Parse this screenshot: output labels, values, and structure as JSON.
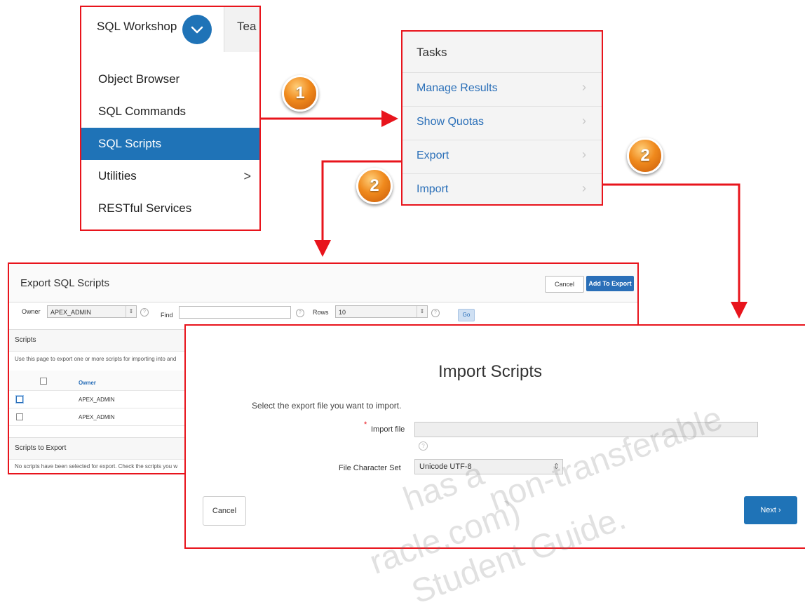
{
  "menu": {
    "tabs": [
      "SQL Workshop",
      "Tea"
    ],
    "items": [
      {
        "label": "Object Browser"
      },
      {
        "label": "SQL Commands"
      },
      {
        "label": "SQL Scripts"
      },
      {
        "label": "Utilities",
        "arrow": ">"
      },
      {
        "label": "RESTful Services"
      }
    ]
  },
  "tasks": {
    "title": "Tasks",
    "items": [
      "Manage Results",
      "Show Quotas",
      "Export",
      "Import"
    ]
  },
  "badges": {
    "one": "1",
    "two": "2"
  },
  "export": {
    "title": "Export SQL Scripts",
    "cancel_label": "Cancel",
    "add_label": "Add To Export",
    "owner_label": "Owner",
    "owner_value": "APEX_ADMIN",
    "find_label": "Find",
    "rows_label": "Rows",
    "rows_value": "10",
    "go_label": "Go",
    "scripts_heading": "Scripts",
    "scripts_desc": "Use this page to export one or more scripts for importing into and",
    "owner_col": "Owner",
    "rows": [
      "APEX_ADMIN",
      "APEX_ADMIN"
    ],
    "to_export_heading": "Scripts to Export",
    "to_export_desc": "No scripts have been selected for export. Check the scripts you w"
  },
  "import": {
    "title": "Import Scripts",
    "instruction": "Select the export file you want to import.",
    "required_mark": "*",
    "file_label": "Import file",
    "charset_label": "File Character Set",
    "charset_value": "Unicode UTF-8",
    "cancel_label": "Cancel",
    "next_label": "Next",
    "next_arrow": "›"
  },
  "watermark": {
    "line1": "non-transferable",
    "line2": "has a",
    "line3": "racle.com)",
    "line4": "Student Guide."
  },
  "colors": {
    "arrow": "#e8141c",
    "accent_blue": "#1f73b7",
    "badge_orange": "#f08a1d"
  }
}
